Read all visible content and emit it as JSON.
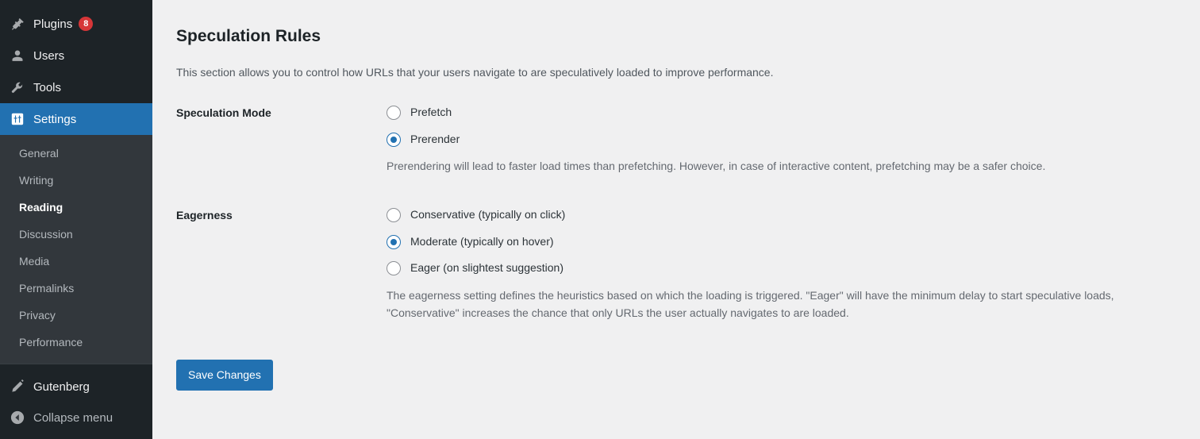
{
  "sidebar": {
    "menu": [
      {
        "label": "Plugins",
        "icon": "plug-icon",
        "badge": "8",
        "current": false
      },
      {
        "label": "Users",
        "icon": "user-icon",
        "badge": "",
        "current": false
      },
      {
        "label": "Tools",
        "icon": "wrench-icon",
        "badge": "",
        "current": false
      },
      {
        "label": "Settings",
        "icon": "settings-sliders-icon",
        "badge": "",
        "current": true
      }
    ],
    "submenu": [
      {
        "label": "General",
        "current": false
      },
      {
        "label": "Writing",
        "current": false
      },
      {
        "label": "Reading",
        "current": true
      },
      {
        "label": "Discussion",
        "current": false
      },
      {
        "label": "Media",
        "current": false
      },
      {
        "label": "Permalinks",
        "current": false
      },
      {
        "label": "Privacy",
        "current": false
      },
      {
        "label": "Performance",
        "current": false
      }
    ],
    "bottom": {
      "gutenberg_label": "Gutenberg",
      "collapse_label": "Collapse menu"
    }
  },
  "main": {
    "title": "Speculation Rules",
    "intro": "This section allows you to control how URLs that your users navigate to are speculatively loaded to improve performance.",
    "speculation_mode": {
      "label": "Speculation Mode",
      "options": [
        {
          "label": "Prefetch",
          "checked": false
        },
        {
          "label": "Prerender",
          "checked": true
        }
      ],
      "description": "Prerendering will lead to faster load times than prefetching. However, in case of interactive content, prefetching may be a safer choice."
    },
    "eagerness": {
      "label": "Eagerness",
      "options": [
        {
          "label": "Conservative (typically on click)",
          "checked": false
        },
        {
          "label": "Moderate (typically on hover)",
          "checked": true
        },
        {
          "label": "Eager (on slightest suggestion)",
          "checked": false
        }
      ],
      "description": "The eagerness setting defines the heuristics based on which the loading is triggered. \"Eager\" will have the minimum delay to start speculative loads, \"Conservative\" increases the chance that only URLs the user actually navigates to are loaded."
    },
    "save_label": "Save Changes"
  },
  "colors": {
    "sidebar_bg": "#1d2327",
    "submenu_bg": "#32373c",
    "accent": "#2271b1",
    "badge": "#d63638",
    "content_bg": "#f0f0f1"
  }
}
